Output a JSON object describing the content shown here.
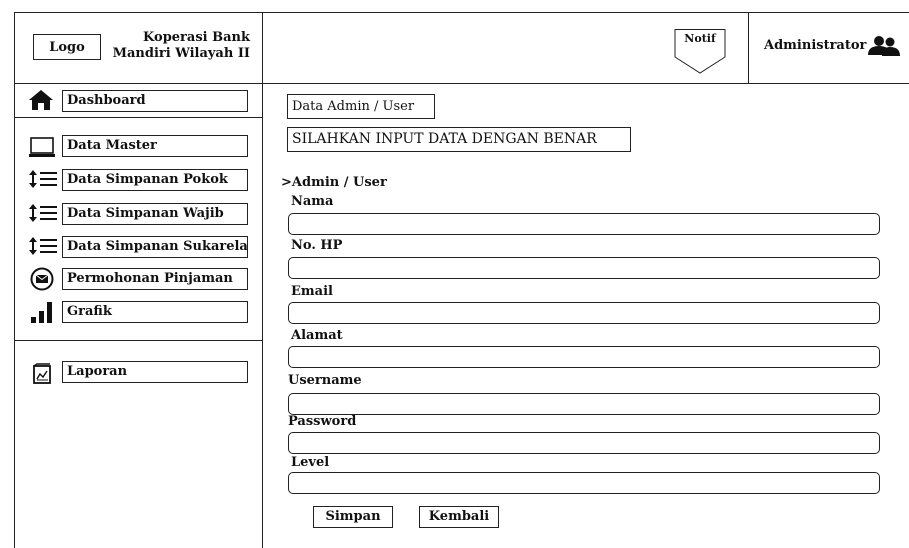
{
  "header": {
    "logo_label": "Logo",
    "app_title_line1": "Koperasi Bank",
    "app_title_line2": "Mandiri Wilayah II",
    "notif_label": "Notif",
    "user_label": "Administrator"
  },
  "sidebar": {
    "items": [
      {
        "label": "Dashboard",
        "icon": "home-icon"
      },
      {
        "label": "Data Master",
        "icon": "monitor-icon"
      },
      {
        "label": "Data Simpanan Pokok",
        "icon": "sort-list-icon"
      },
      {
        "label": "Data Simpanan Wajib",
        "icon": "sort-list-icon"
      },
      {
        "label": "Data Simpanan Sukarela",
        "icon": "sort-list-icon"
      },
      {
        "label": "Permohonan Pinjaman",
        "icon": "mail-icon"
      },
      {
        "label": "Grafik",
        "icon": "bar-chart-icon"
      },
      {
        "label": "Laporan",
        "icon": "report-icon"
      }
    ]
  },
  "main": {
    "page_title": "Data Admin / User",
    "instruction": "SILAHKAN INPUT DATA DENGAN BENAR",
    "breadcrumb": ">Admin / User",
    "fields": [
      {
        "label": "Nama",
        "value": ""
      },
      {
        "label": "No. HP",
        "value": ""
      },
      {
        "label": "Email",
        "value": ""
      },
      {
        "label": "Alamat",
        "value": ""
      },
      {
        "label": "Username",
        "value": ""
      },
      {
        "label": "Password",
        "value": ""
      },
      {
        "label": "Level",
        "value": ""
      }
    ],
    "save_label": "Simpan",
    "back_label": "Kembali"
  }
}
